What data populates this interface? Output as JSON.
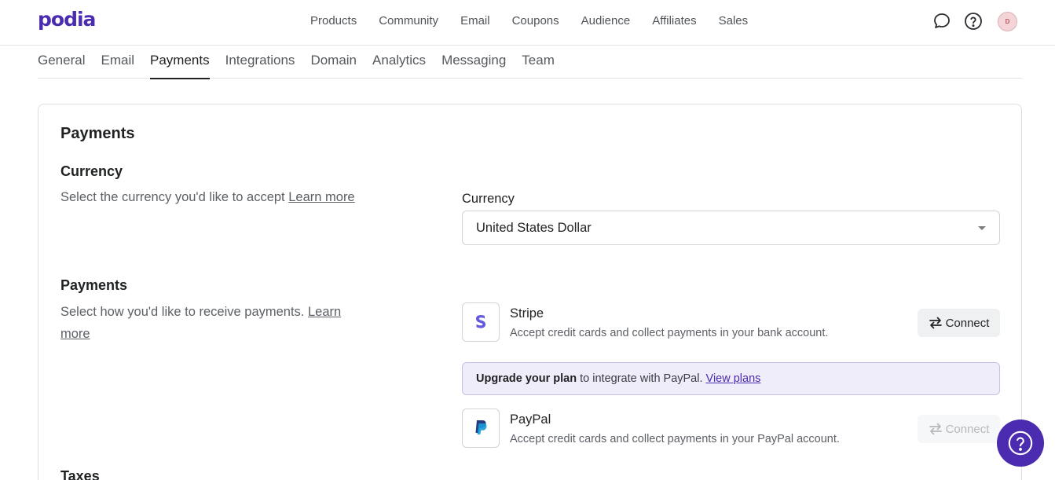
{
  "brand": {
    "logo_text": "podia",
    "accent": "#4b2bb0"
  },
  "topnav": {
    "items": [
      "Products",
      "Community",
      "Email",
      "Coupons",
      "Audience",
      "Affiliates",
      "Sales"
    ]
  },
  "topbar": {
    "chat_icon": "chat-bubble-icon",
    "help_icon": "help-circle-icon",
    "avatar_initial": "D"
  },
  "subtabs": {
    "items": [
      "General",
      "Email",
      "Payments",
      "Integrations",
      "Domain",
      "Analytics",
      "Messaging",
      "Team"
    ],
    "active": "Payments"
  },
  "card": {
    "title": "Payments",
    "currency_section": {
      "title": "Currency",
      "desc": "Select the currency you'd like to accept",
      "link": "Learn more",
      "field_label": "Currency",
      "selected": "United States Dollar"
    },
    "payments_section": {
      "title": "Payments",
      "desc": "Select how you'd like to receive payments.",
      "link": "Learn more"
    },
    "stripe": {
      "name": "Stripe",
      "desc": "Accept credit cards and collect payments in your bank account.",
      "button": "Connect"
    },
    "upgrade_banner": {
      "bold": "Upgrade your plan",
      "text": " to integrate with PayPal. ",
      "link": "View plans"
    },
    "paypal": {
      "name": "PayPal",
      "desc": "Accept credit cards and collect payments in your PayPal account.",
      "button": "Connect"
    },
    "taxes_section": {
      "title": "Taxes"
    }
  }
}
